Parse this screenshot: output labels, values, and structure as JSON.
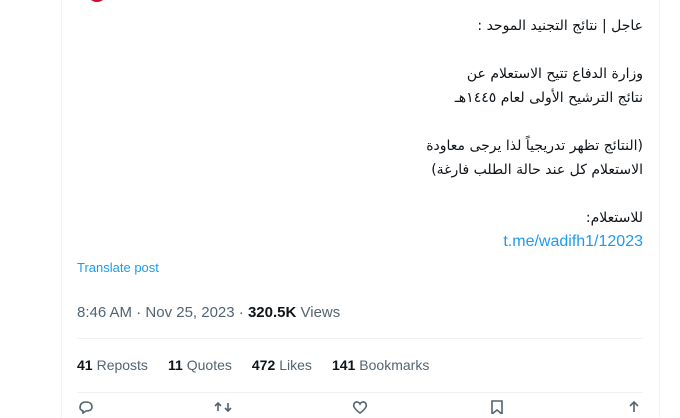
{
  "tweet": {
    "lines": [
      "عاجل | نتائج التجنيد الموحد :",
      "",
      "وزارة الدفاع تتيح الاستعلام عن",
      "نتائج الترشيح الأولى لعام ١٤٤٥هـ",
      "",
      "(النتائج تظهر تدريجياً لذا يرجى معاودة",
      "الاستعلام كل عند حالة الطلب فارغة)",
      "",
      "للاستعلام:"
    ],
    "link": "t.me/wadifh1/12023"
  },
  "translate_label": "Translate post",
  "meta": {
    "time": "8:46 AM",
    "sep1": " · ",
    "date": "Nov 25, 2023",
    "sep2": " · ",
    "views_count": "320.5K",
    "views_label": "Views"
  },
  "stats": {
    "reposts": {
      "count": "41",
      "label": "Reposts"
    },
    "quotes": {
      "count": "11",
      "label": "Quotes"
    },
    "likes": {
      "count": "472",
      "label": "Likes"
    },
    "bookmarks": {
      "count": "141",
      "label": "Bookmarks"
    }
  },
  "actions": [
    "reply-icon",
    "repost-icon",
    "like-icon",
    "bookmark-icon",
    "share-icon"
  ],
  "colors": {
    "link": "#1d9bf0",
    "muted": "#536471",
    "text": "#0f1419",
    "divider": "#eff3f4"
  }
}
